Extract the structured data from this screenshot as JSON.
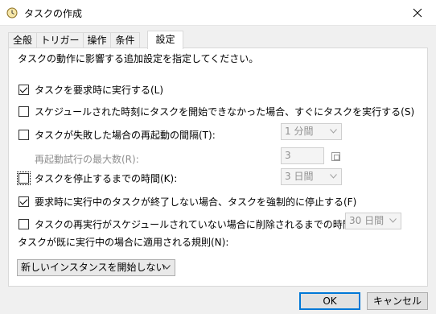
{
  "window": {
    "title": "タスクの作成",
    "close_glyph": "✕"
  },
  "tabs": [
    {
      "label": "全般"
    },
    {
      "label": "トリガー"
    },
    {
      "label": "操作"
    },
    {
      "label": "条件"
    },
    {
      "label": "設定",
      "active": true
    }
  ],
  "settings": {
    "intro": "タスクの動作に影響する追加設定を指定してください。",
    "run_on_demand": {
      "label": "タスクを要求時に実行する(L)",
      "checked": true
    },
    "run_after_missed": {
      "label": "スケジュールされた時刻にタスクを開始できなかった場合、すぐにタスクを実行する(S)",
      "checked": false
    },
    "restart_on_failure": {
      "label": "タスクが失敗した場合の再起動の間隔(T):",
      "checked": false,
      "interval": "1 分間"
    },
    "max_restarts": {
      "label": "再起動試行の最大数(R):",
      "value": "3"
    },
    "stop_if_runs_longer": {
      "label": "タスクを停止するまでの時間(K):",
      "checked": false,
      "duration": "3 日間"
    },
    "force_stop": {
      "label": "要求時に実行中のタスクが終了しない場合、タスクを強制的に停止する(F)",
      "checked": true
    },
    "delete_if_not_scheduled": {
      "label": "タスクの再実行がスケジュールされていない場合に削除されるまでの時間(D):",
      "checked": false,
      "duration": "30 日間"
    },
    "rule_label": "タスクが既に実行中の場合に適用される規則(N):",
    "rule_value": "新しいインスタンスを開始しない"
  },
  "buttons": {
    "ok": "OK",
    "cancel": "キャンセル"
  }
}
